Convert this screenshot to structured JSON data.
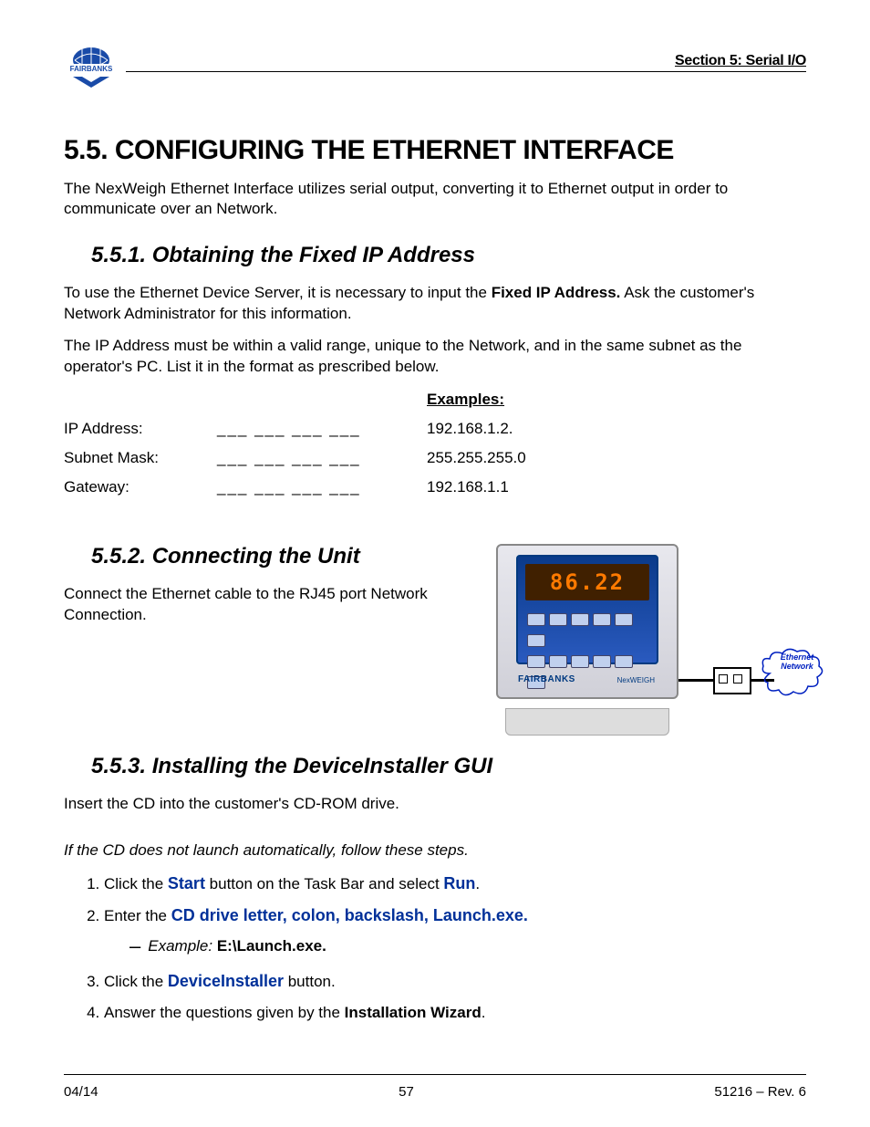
{
  "header": {
    "section_label": "Section 5: Serial I/O",
    "logo_text": "FAIRBANKS"
  },
  "main_heading": "5.5.  CONFIGURING THE ETHERNET INTERFACE",
  "intro": "The NexWeigh Ethernet Interface utilizes serial output, converting it to Ethernet output in order to communicate over an Network.",
  "s551": {
    "heading": "5.5.1.  Obtaining the Fixed IP Address",
    "p1_pre": "To use the Ethernet Device Server, it is necessary to input the ",
    "p1_bold": "Fixed IP Address.",
    "p1_post": " Ask the customer's Network Administrator for this information.",
    "p2": "The IP Address must be within a valid range, unique to the Network, and in the same subnet as the operator's PC.  List it in the format as prescribed below.",
    "examples_label": "Examples:",
    "rows": [
      {
        "label": "IP Address:",
        "blanks": "___ ___ ___ ___",
        "value": "192.168.1.2."
      },
      {
        "label": "Subnet Mask:",
        "blanks": "___ ___ ___ ___",
        "value": "255.255.255.0"
      },
      {
        "label": "Gateway:",
        "blanks": "___ ___ ___ ___",
        "value": "192.168.1.1"
      }
    ]
  },
  "s552": {
    "heading": "5.5.2.  Connecting the Unit",
    "p1": "Connect the Ethernet cable to the RJ45 port Network Connection.",
    "device_display": "86.22",
    "device_brand": "FAIRBANKS",
    "device_model": "NexWEIGH",
    "cloud_label": "Ethernet Network"
  },
  "s553": {
    "heading": "5.5.3.  Installing the DeviceInstaller GUI",
    "p1": "Insert the CD into the customer's CD-ROM drive.",
    "p2": "If the CD does not launch automatically, follow these steps.",
    "step1_a": "Click the ",
    "step1_b": "Start",
    "step1_c": " button on the Task Bar and select ",
    "step1_d": "Run",
    "step1_e": ".",
    "step2_a": "Enter the ",
    "step2_b": "CD drive letter, colon, backslash, Launch.exe.",
    "step2_ex_a": "Example: ",
    "step2_ex_b": "E:\\Launch.exe.",
    "step3_a": "Click the ",
    "step3_b": "DeviceInstaller",
    "step3_c": " button.",
    "step4_a": "Answer the questions given by the ",
    "step4_b": "Installation Wizard",
    "step4_c": "."
  },
  "footer": {
    "left": "04/14",
    "center": "57",
    "right": "51216 – Rev. 6"
  }
}
